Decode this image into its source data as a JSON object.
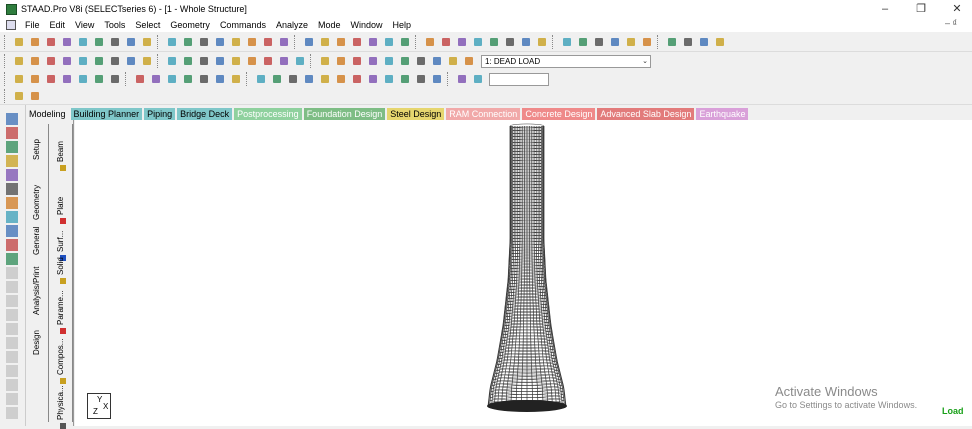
{
  "window": {
    "title": "STAAD.Pro V8i (SELECTseries 6) - [1 - Whole Structure]",
    "controls": {
      "minimize": "–",
      "maximize": "❐",
      "close": "✕"
    },
    "mdi_controls": "– ₫"
  },
  "menu": {
    "items": [
      "File",
      "Edit",
      "View",
      "Tools",
      "Select",
      "Geometry",
      "Commands",
      "Analyze",
      "Mode",
      "Window",
      "Help"
    ]
  },
  "toolbar": {
    "load_case": "1: DEAD LOAD",
    "spin_value": ""
  },
  "mode_tabs": [
    {
      "label": "Modeling",
      "color": "#f0f0f0",
      "text": "#000000"
    },
    {
      "label": "Building Planner",
      "color": "#7fc7c9",
      "text": "#000000"
    },
    {
      "label": "Piping",
      "color": "#7fc7c9",
      "text": "#000000"
    },
    {
      "label": "Bridge Deck",
      "color": "#7fc7c9",
      "text": "#000000"
    },
    {
      "label": "Postprocessing",
      "color": "#8fd19e",
      "text": "#ffffff"
    },
    {
      "label": "Foundation Design",
      "color": "#7ebd85",
      "text": "#ffffff"
    },
    {
      "label": "Steel Design",
      "color": "#e6d66f",
      "text": "#000000"
    },
    {
      "label": "RAM Connection",
      "color": "#f1a9a9",
      "text": "#ffffff"
    },
    {
      "label": "Concrete Design",
      "color": "#ef8a8a",
      "text": "#ffffff"
    },
    {
      "label": "Advanced Slab Design",
      "color": "#e27b7b",
      "text": "#ffffff"
    },
    {
      "label": "Earthquake",
      "color": "#d9a0d9",
      "text": "#ffffff"
    }
  ],
  "side_panel": {
    "outer_tabs": [
      "Setup",
      "Geometry",
      "General",
      "Analysis/Print",
      "Design"
    ],
    "inner_tabs": [
      "Beam",
      "Plate",
      "Surf...",
      "Solid",
      "Parame...",
      "Compos...",
      "Physica..."
    ]
  },
  "viewport": {
    "axis": {
      "x": "X",
      "y": "Y",
      "z": "Z"
    },
    "watermark_title": "Activate Windows",
    "watermark_subtitle": "Go to Settings to activate Windows.",
    "status_fragment": "Load"
  },
  "colors": {
    "mesh": "#3a3a3a",
    "accent_green": "#19a019"
  }
}
